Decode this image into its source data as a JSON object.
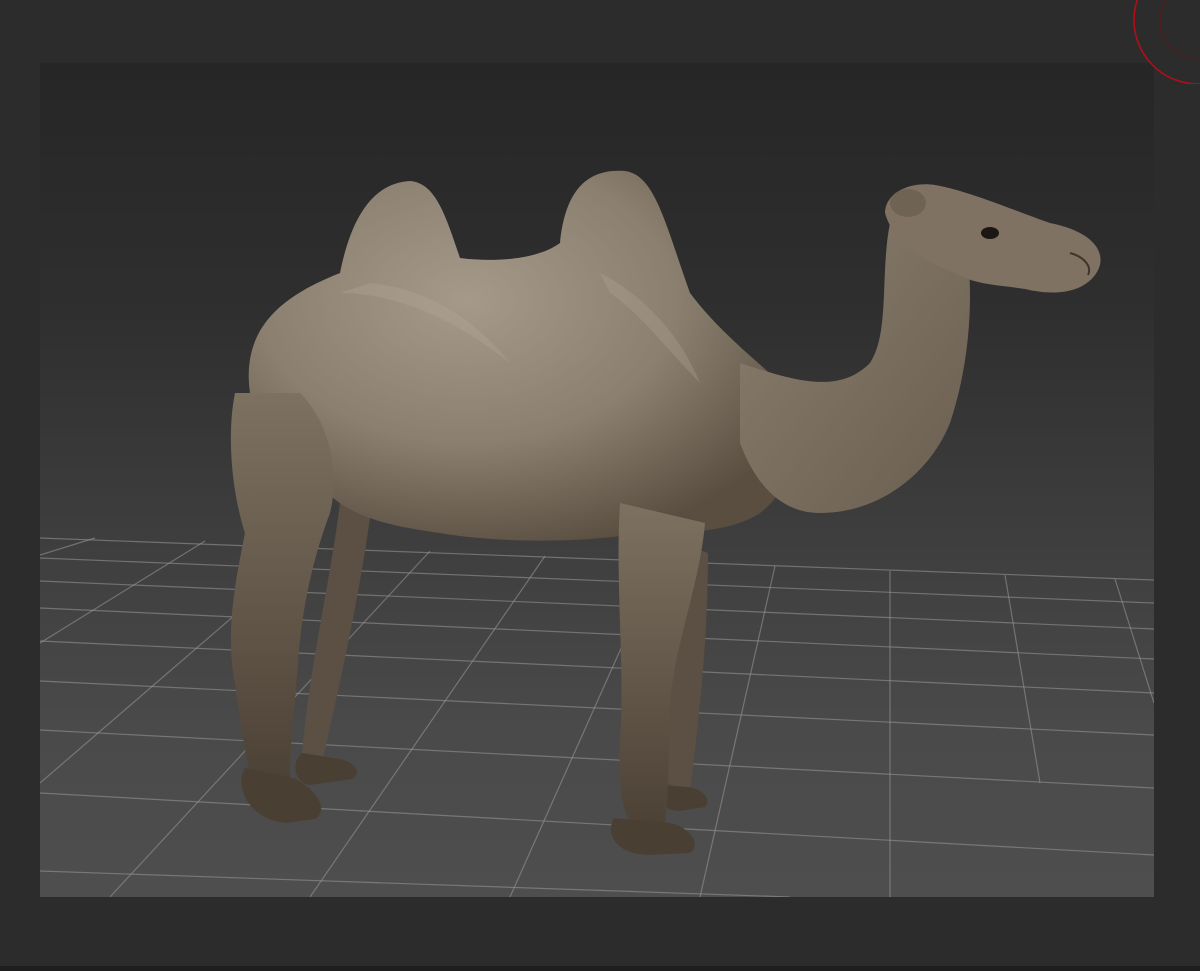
{
  "app": {
    "title": ""
  },
  "viewport": {
    "label": "",
    "subject": "camel-3d-model",
    "background_colors": [
      "#262626",
      "#4e4e4e"
    ],
    "grid_color": "#8a8a8a",
    "gizmo_color": "#c0101a",
    "model_colors": [
      "#8e8272",
      "#6e6254",
      "#4a3f33",
      "#a59a8a"
    ]
  }
}
